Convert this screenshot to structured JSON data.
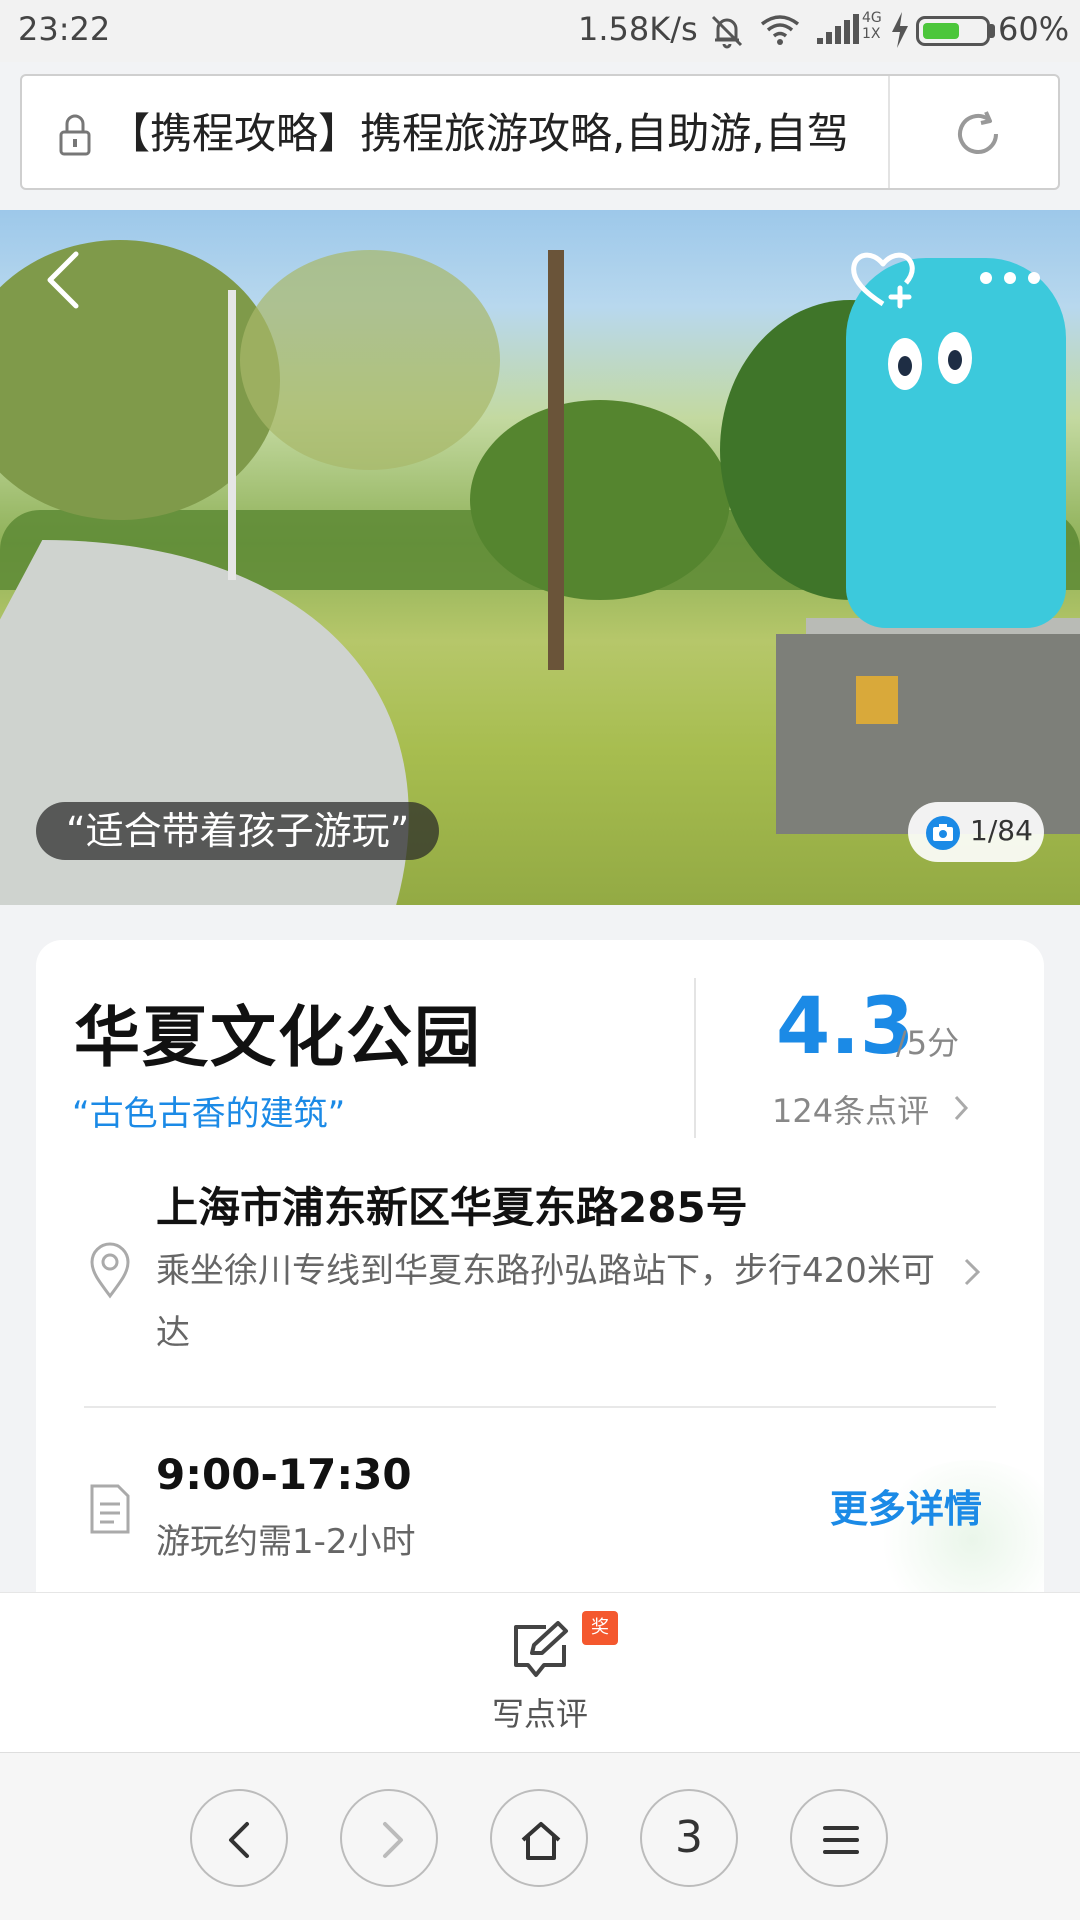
{
  "status_bar": {
    "time": "23:22",
    "net_speed": "1.58K/s",
    "network_label": "4G\n1X",
    "battery_percent_label": "60%",
    "battery_level": 0.6,
    "battery_color": "#4cc63b"
  },
  "url_bar": {
    "lock_icon": "lock-icon",
    "page_title": "【携程攻略】携程旅游攻略,自助游,自驾",
    "reload_icon": "reload-icon"
  },
  "hero": {
    "back_icon": "chevron-left-icon",
    "favorite_icon": "heart-plus-icon",
    "more_icon": "more-dots-icon",
    "quote": "“适合带着孩子游玩”",
    "photo_counter": "1/84",
    "camera_icon": "camera-icon"
  },
  "poi": {
    "name": "华夏文化公园",
    "tagline": "“古色古香的建筑”",
    "score": "4.3",
    "score_unit": "/5分",
    "review_count": "124条点评",
    "address": "上海市浦东新区华夏东路285号",
    "directions": "乘坐徐川专线到华夏东路孙弘路站下，步行420米可达",
    "hours": "9:00-17:30",
    "duration": "游玩约需1-2小时",
    "more_details": "更多详情",
    "accent_color": "#1b8ae6"
  },
  "review_bar": {
    "write_label": "写点评",
    "badge": "奖",
    "badge_color": "#f4582e"
  },
  "browser_nav": {
    "tabs_count": "3"
  }
}
